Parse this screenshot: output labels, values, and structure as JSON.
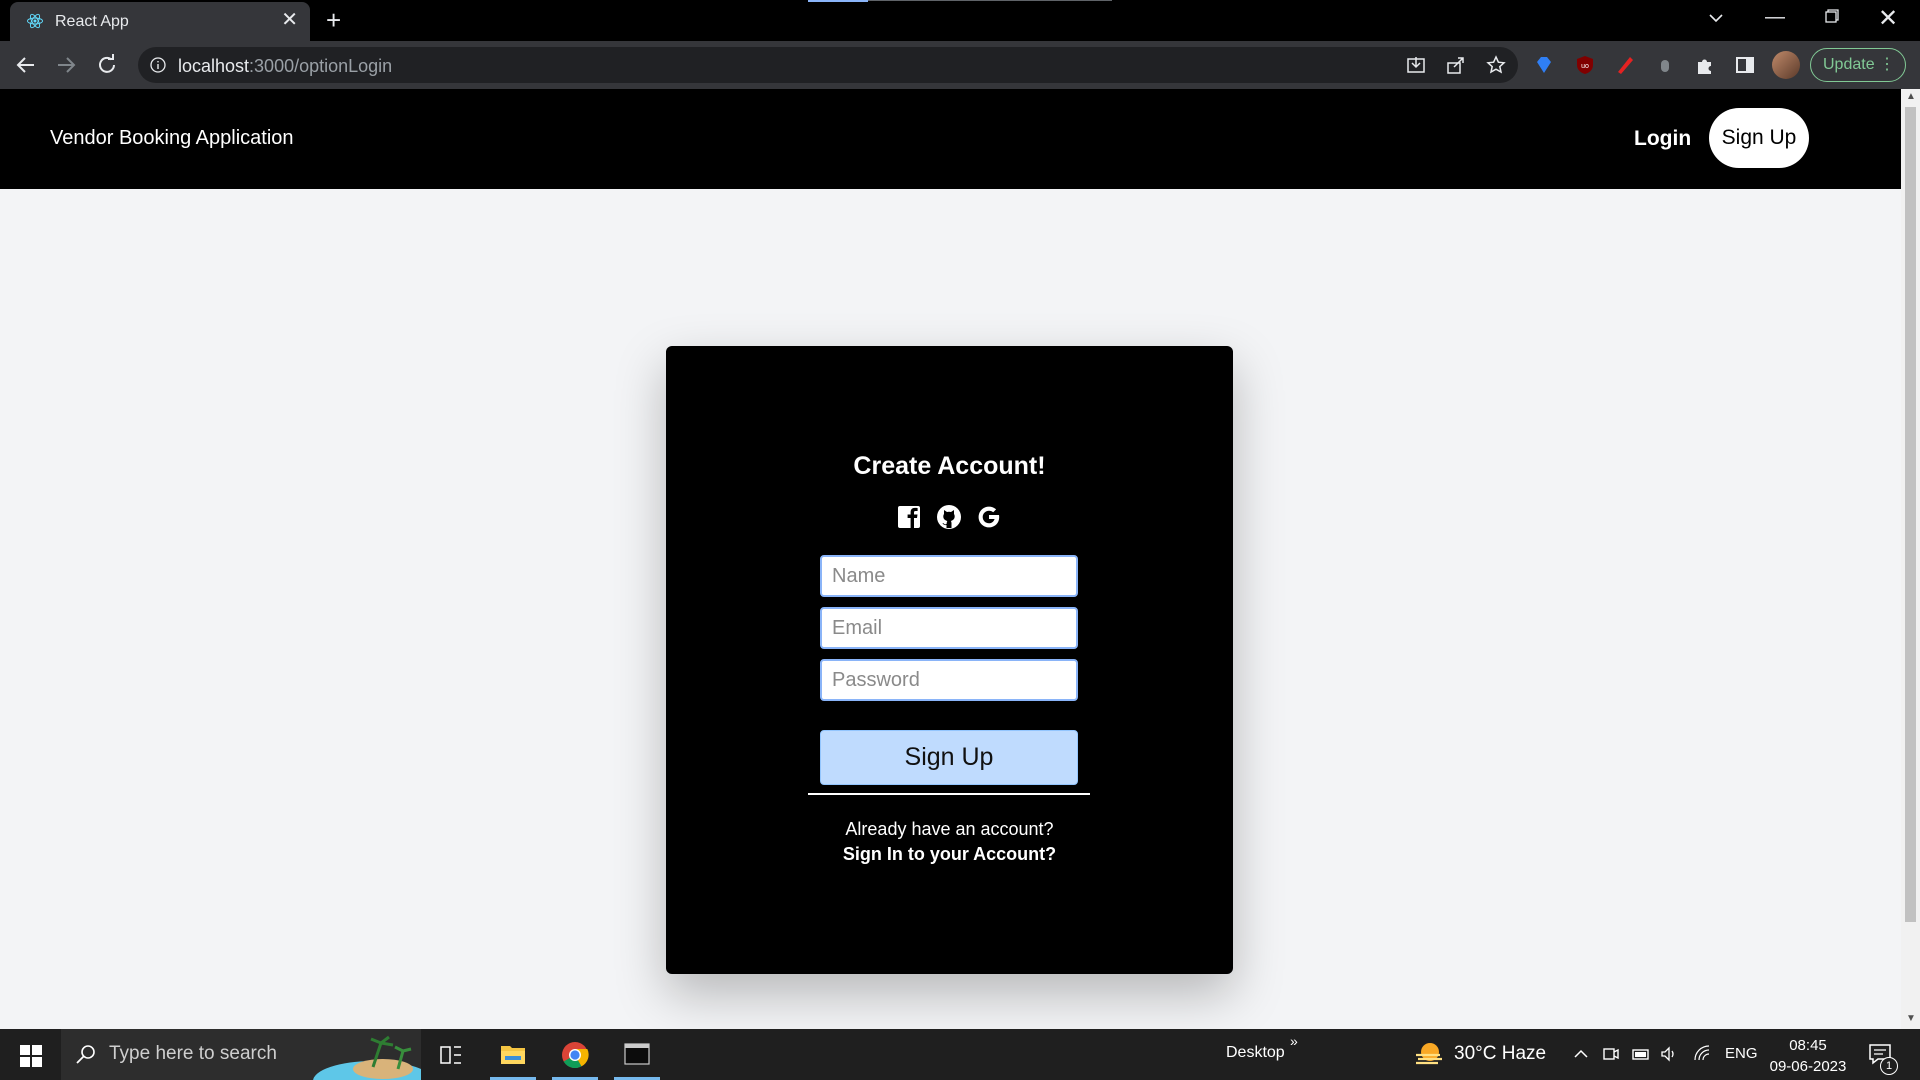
{
  "browser": {
    "tab_title": "React App",
    "new_tab_symbol": "+",
    "url_host": "localhost",
    "url_path": ":3000/optionLogin",
    "update_label": "Update"
  },
  "page": {
    "brand": "Vendor Booking Application",
    "nav_login": "Login",
    "nav_signup": "Sign Up",
    "card": {
      "title": "Create Account!",
      "social_icons": [
        "facebook-icon",
        "github-icon",
        "google-icon"
      ],
      "name_placeholder": "Name",
      "email_placeholder": "Email",
      "password_placeholder": "Password",
      "submit_label": "Sign Up",
      "already_text": "Already have an account?",
      "signin_link": "Sign In to your Account?"
    }
  },
  "taskbar": {
    "search_placeholder": "Type here to search",
    "desktop_label": "Desktop",
    "weather": "30°C  Haze",
    "language": "ENG",
    "time": "08:45",
    "date": "09-06-2023",
    "notification_count": "1"
  },
  "colors": {
    "navbar_bg": "#000000",
    "page_bg": "#f3f4f6",
    "submit_bg": "#bfdbfe",
    "update_green": "#81c995"
  }
}
